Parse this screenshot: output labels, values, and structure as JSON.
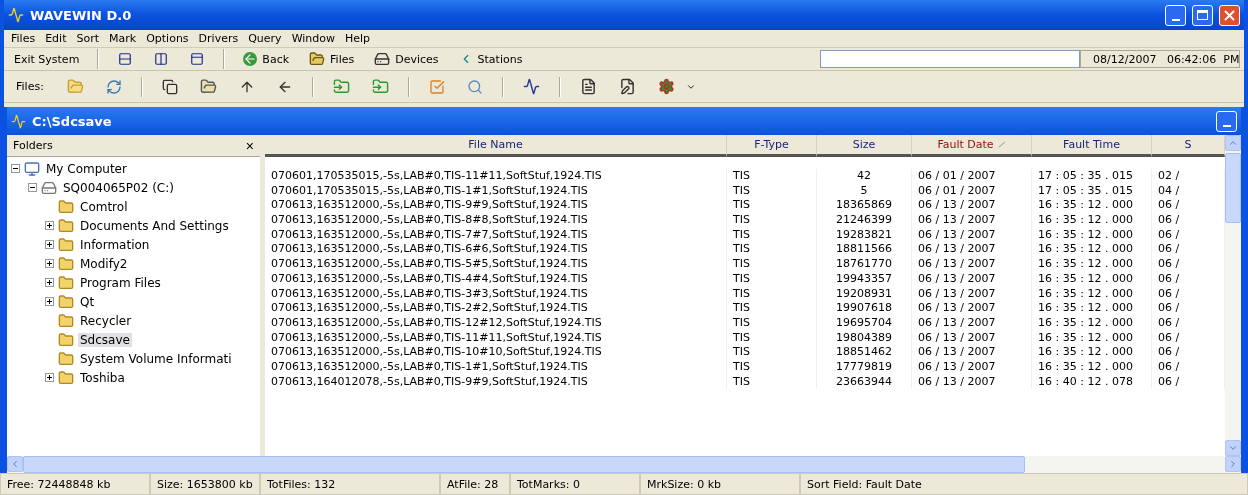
{
  "window": {
    "title": "WAVEWIN D.0"
  },
  "menu": [
    "Files",
    "Edit",
    "Sort",
    "Mark",
    "Options",
    "Drivers",
    "Query",
    "Window",
    "Help"
  ],
  "toolbar": {
    "exit": "Exit System",
    "nav": [
      {
        "label": "Back",
        "kind": "back"
      },
      {
        "label": "Files",
        "kind": "files"
      },
      {
        "label": "Devices",
        "kind": "devices"
      },
      {
        "label": "Stations",
        "kind": "stations"
      }
    ],
    "datetime": "08/12/2007   06:42:06  PM"
  },
  "files_toolbar": {
    "label": "Files:"
  },
  "child": {
    "title": "C:\\Sdcsave"
  },
  "folders": {
    "title": "Folders",
    "close": "×",
    "tree": [
      {
        "label": "My Computer",
        "kind": "computer",
        "expanded": true,
        "selected": false,
        "children": [
          {
            "label": "SQ004065P02 (C:)",
            "kind": "drive",
            "expanded": true,
            "selected": false,
            "children": [
              {
                "label": "Comtrol",
                "kind": "folder",
                "selected": false
              },
              {
                "label": "Documents And Settings",
                "kind": "folder",
                "expanded": false,
                "selected": false
              },
              {
                "label": "Information",
                "kind": "folder",
                "expanded": false,
                "selected": false
              },
              {
                "label": "Modify2",
                "kind": "folder",
                "expanded": false,
                "selected": false
              },
              {
                "label": "Program Files",
                "kind": "folder",
                "expanded": false,
                "selected": false
              },
              {
                "label": "Qt",
                "kind": "folder",
                "expanded": false,
                "selected": false
              },
              {
                "label": "Recycler",
                "kind": "folder",
                "selected": false
              },
              {
                "label": "Sdcsave",
                "kind": "folder",
                "selected": true
              },
              {
                "label": "System Volume Informati",
                "kind": "folder",
                "selected": false
              },
              {
                "label": "Toshiba",
                "kind": "folder",
                "expanded": false,
                "selected": false
              }
            ]
          }
        ]
      }
    ]
  },
  "table": {
    "columns": [
      {
        "label": "File Name",
        "sorted": false
      },
      {
        "label": "F-Type",
        "sorted": false
      },
      {
        "label": "Size",
        "sorted": false
      },
      {
        "label": "Fault Date",
        "sorted": true
      },
      {
        "label": "Fault Time",
        "sorted": false
      },
      {
        "label": "S",
        "sorted": false
      }
    ],
    "rows": [
      [
        "070601,170535015,-5s,LAB#0,TIS-11#11,SoftStuf,1924.TIS",
        "TIS",
        "42",
        "06 / 01 / 2007",
        "17 : 05 : 35 . 015",
        "02 /"
      ],
      [
        "070601,170535015,-5s,LAB#0,TIS-1#1,SoftStuf,1924.TIS",
        "TIS",
        "5",
        "06 / 01 / 2007",
        "17 : 05 : 35 . 015",
        "04 /"
      ],
      [
        "070613,163512000,-5s,LAB#0,TIS-9#9,SoftStuf,1924.TIS",
        "TIS",
        "18365869",
        "06 / 13 / 2007",
        "16 : 35 : 12 . 000",
        "06 /"
      ],
      [
        "070613,163512000,-5s,LAB#0,TIS-8#8,SoftStuf,1924.TIS",
        "TIS",
        "21246399",
        "06 / 13 / 2007",
        "16 : 35 : 12 . 000",
        "06 /"
      ],
      [
        "070613,163512000,-5s,LAB#0,TIS-7#7,SoftStuf,1924.TIS",
        "TIS",
        "19283821",
        "06 / 13 / 2007",
        "16 : 35 : 12 . 000",
        "06 /"
      ],
      [
        "070613,163512000,-5s,LAB#0,TIS-6#6,SoftStuf,1924.TIS",
        "TIS",
        "18811566",
        "06 / 13 / 2007",
        "16 : 35 : 12 . 000",
        "06 /"
      ],
      [
        "070613,163512000,-5s,LAB#0,TIS-5#5,SoftStuf,1924.TIS",
        "TIS",
        "18761770",
        "06 / 13 / 2007",
        "16 : 35 : 12 . 000",
        "06 /"
      ],
      [
        "070613,163512000,-5s,LAB#0,TIS-4#4,SoftStuf,1924.TIS",
        "TIS",
        "19943357",
        "06 / 13 / 2007",
        "16 : 35 : 12 . 000",
        "06 /"
      ],
      [
        "070613,163512000,-5s,LAB#0,TIS-3#3,SoftStuf,1924.TIS",
        "TIS",
        "19208931",
        "06 / 13 / 2007",
        "16 : 35 : 12 . 000",
        "06 /"
      ],
      [
        "070613,163512000,-5s,LAB#0,TIS-2#2,SoftStuf,1924.TIS",
        "TIS",
        "19907618",
        "06 / 13 / 2007",
        "16 : 35 : 12 . 000",
        "06 /"
      ],
      [
        "070613,163512000,-5s,LAB#0,TIS-12#12,SoftStuf,1924.TIS",
        "TIS",
        "19695704",
        "06 / 13 / 2007",
        "16 : 35 : 12 . 000",
        "06 /"
      ],
      [
        "070613,163512000,-5s,LAB#0,TIS-11#11,SoftStuf,1924.TIS",
        "TIS",
        "19804389",
        "06 / 13 / 2007",
        "16 : 35 : 12 . 000",
        "06 /"
      ],
      [
        "070613,163512000,-5s,LAB#0,TIS-10#10,SoftStuf,1924.TIS",
        "TIS",
        "18851462",
        "06 / 13 / 2007",
        "16 : 35 : 12 . 000",
        "06 /"
      ],
      [
        "070613,163512000,-5s,LAB#0,TIS-1#1,SoftStuf,1924.TIS",
        "TIS",
        "17779819",
        "06 / 13 / 2007",
        "16 : 35 : 12 . 000",
        "06 /"
      ],
      [
        "070613,164012078,-5s,LAB#0,TIS-9#9,SoftStuf,1924.TIS",
        "TIS",
        "23663944",
        "06 / 13 / 2007",
        "16 : 40 : 12 . 078",
        "06 /"
      ]
    ]
  },
  "status_bar": [
    "Free: 72448848 kb",
    "Size: 1653800 kb",
    "TotFiles: 132",
    "AtFile: 28",
    "TotMarks: 0",
    "MrkSize: 0 kb",
    "Sort Field: Fault Date"
  ]
}
